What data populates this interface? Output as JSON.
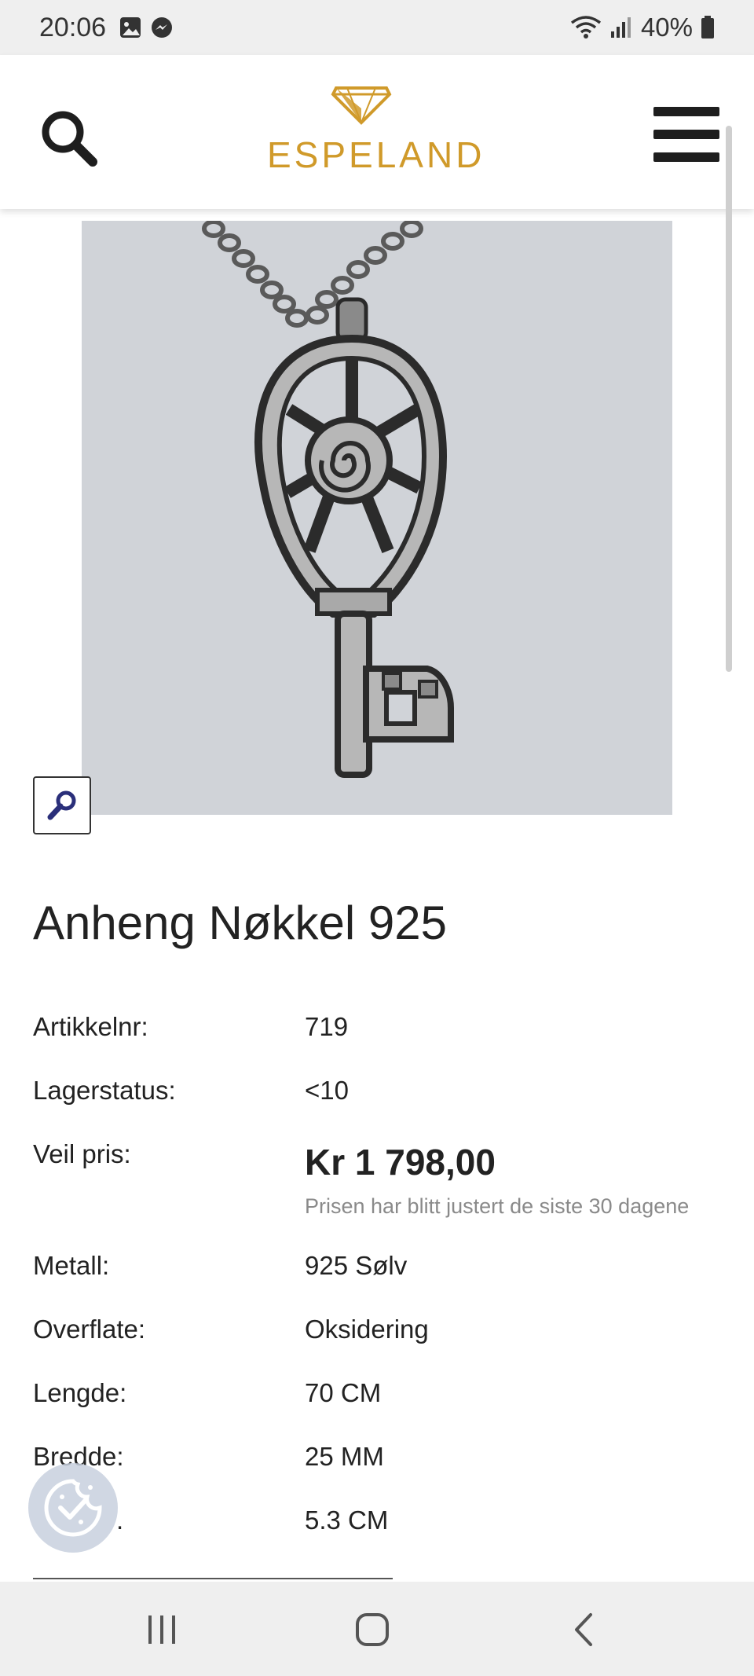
{
  "status_bar": {
    "time": "20:06",
    "battery": "40%",
    "icons": [
      "gallery-icon",
      "messenger-icon",
      "wifi-icon",
      "signal-icon",
      "battery-icon"
    ]
  },
  "header": {
    "logo_text": "ESPELAND",
    "brand_color": "#d09a2a",
    "search_icon": "search-icon",
    "menu_icon": "hamburger-menu-icon"
  },
  "product": {
    "image_alt": "Anheng Nøkkel 925",
    "title": "Anheng Nøkkel 925",
    "specs": {
      "article_label": "Artikkelnr:",
      "article_value": "719",
      "stock_label": "Lagerstatus:",
      "stock_value": "<10",
      "price_label": "Veil pris:",
      "price_value": "Kr 1 798,00",
      "price_note": "Prisen har blitt justert de siste 30 dagene",
      "metal_label": "Metall:",
      "metal_value": "925 Sølv",
      "surface_label": "Overflate:",
      "surface_value": "Oksidering",
      "length_label": "Lengde:",
      "length_value": "70 CM",
      "width_label": "Bredde:",
      "width_value": "25 MM",
      "height_label": ".",
      "height_value": "5.3 CM"
    }
  },
  "nav": {
    "recents_icon": "recent-apps-icon",
    "home_icon": "home-icon",
    "back_icon": "back-icon"
  }
}
